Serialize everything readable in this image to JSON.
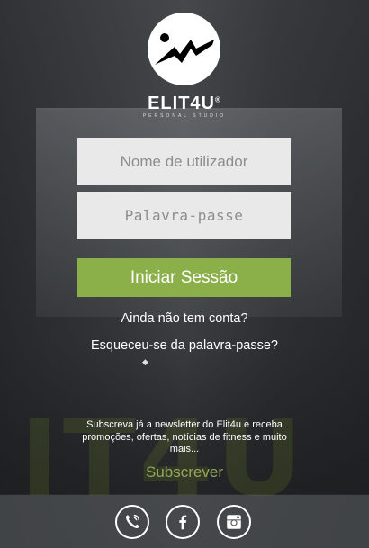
{
  "brand": {
    "name": "ELIT4U",
    "trademark": "®",
    "tagline": "PERSONAL STUDIO"
  },
  "login": {
    "username_placeholder": "Nome de utilizador",
    "password_placeholder": "Palavra-passe",
    "submit_label": "Iniciar Sessão",
    "no_account_label": "Ainda não tem conta?",
    "forgot_label": "Esqueceu-se da palavra-passe?"
  },
  "newsletter": {
    "text": "Subscreva já a newsletter do Elit4u e receba promoções, ofertas, notícias de fitness e muito mais...",
    "subscribe_label": "Subscrever"
  },
  "social": {
    "items": [
      {
        "name": "phone-icon"
      },
      {
        "name": "facebook-icon"
      },
      {
        "name": "instagram-icon"
      }
    ]
  },
  "colors": {
    "accent": "#8bb04a",
    "subscribe": "#93a855",
    "field_bg": "#e9e9e9"
  }
}
